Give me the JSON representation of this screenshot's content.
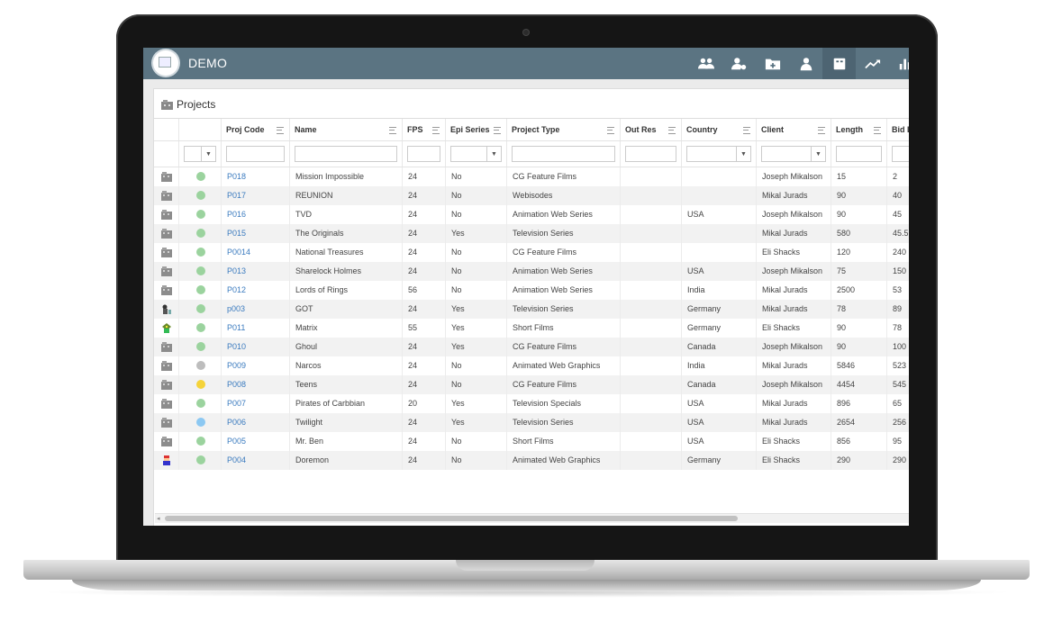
{
  "app": {
    "title": "DEMO"
  },
  "nav": {
    "icons": [
      "users-icon",
      "user-settings-icon",
      "add-folder-icon",
      "user-icon",
      "projects-icon",
      "trend-icon",
      "bar-chart-icon"
    ],
    "active_index": 4
  },
  "panel": {
    "title": "Projects"
  },
  "colors": {
    "topbar": "#5b7482",
    "link": "#3b7bbf",
    "status_green": "#9bd39e",
    "status_grey": "#bdbdbd",
    "status_yellow": "#f5d33a",
    "status_blue": "#8cc8f2"
  },
  "table": {
    "columns": [
      "",
      "",
      "Proj Code",
      "Name",
      "FPS",
      "Epi Series",
      "Project Type",
      "Out Res",
      "Country",
      "Client",
      "Length",
      "Bid L"
    ],
    "rows": [
      {
        "icon": "folder-icon",
        "status": "green",
        "code": "P018",
        "name": "Mission Impossible",
        "fps": "24",
        "epi": "No",
        "type": "CG Feature Films",
        "outres": "",
        "country": "",
        "client": "Joseph Mikalson",
        "length": "15",
        "bid": "2"
      },
      {
        "icon": "folder-icon",
        "status": "green",
        "code": "P017",
        "name": "REUNION",
        "fps": "24",
        "epi": "No",
        "type": "Webisodes",
        "outres": "",
        "country": "",
        "client": "Mikal Jurads",
        "length": "90",
        "bid": "40"
      },
      {
        "icon": "folder-icon",
        "status": "green",
        "code": "P016",
        "name": "TVD",
        "fps": "24",
        "epi": "No",
        "type": "Animation Web Series",
        "outres": "",
        "country": "USA",
        "client": "Joseph Mikalson",
        "length": "90",
        "bid": "45"
      },
      {
        "icon": "folder-icon",
        "status": "green",
        "code": "P015",
        "name": "The Originals",
        "fps": "24",
        "epi": "Yes",
        "type": "Television Series",
        "outres": "",
        "country": "",
        "client": "Mikal Jurads",
        "length": "580",
        "bid": "45.5"
      },
      {
        "icon": "folder-icon",
        "status": "green",
        "code": "P0014",
        "name": "National Treasures",
        "fps": "24",
        "epi": "No",
        "type": "CG Feature Films",
        "outres": "",
        "country": "",
        "client": "Eli Shacks",
        "length": "120",
        "bid": "240"
      },
      {
        "icon": "folder-icon",
        "status": "green",
        "code": "P013",
        "name": "Sharelock Holmes",
        "fps": "24",
        "epi": "No",
        "type": "Animation Web Series",
        "outres": "",
        "country": "USA",
        "client": "Joseph Mikalson",
        "length": "75",
        "bid": "150"
      },
      {
        "icon": "folder-icon",
        "status": "green",
        "code": "P012",
        "name": "Lords of Rings",
        "fps": "56",
        "epi": "No",
        "type": "Animation Web Series",
        "outres": "",
        "country": "India",
        "client": "Mikal Jurads",
        "length": "2500",
        "bid": "53"
      },
      {
        "icon": "character-icon",
        "status": "green",
        "code": "p003",
        "name": "GOT",
        "fps": "24",
        "epi": "Yes",
        "type": "Television Series",
        "outres": "",
        "country": "Germany",
        "client": "Mikal Jurads",
        "length": "78",
        "bid": "89"
      },
      {
        "icon": "sprite-icon",
        "status": "green",
        "code": "P011",
        "name": "Matrix",
        "fps": "55",
        "epi": "Yes",
        "type": "Short Films",
        "outres": "",
        "country": "Germany",
        "client": "Eli Shacks",
        "length": "90",
        "bid": "78"
      },
      {
        "icon": "folder-icon",
        "status": "green",
        "code": "P010",
        "name": "Ghoul",
        "fps": "24",
        "epi": "Yes",
        "type": "CG Feature Films",
        "outres": "",
        "country": "Canada",
        "client": "Joseph Mikalson",
        "length": "90",
        "bid": "100"
      },
      {
        "icon": "folder-icon",
        "status": "grey",
        "code": "P009",
        "name": "Narcos",
        "fps": "24",
        "epi": "No",
        "type": "Animated Web Graphics",
        "outres": "",
        "country": "India",
        "client": "Mikal Jurads",
        "length": "5846",
        "bid": "523"
      },
      {
        "icon": "folder-icon",
        "status": "yellow",
        "code": "P008",
        "name": "Teens",
        "fps": "24",
        "epi": "No",
        "type": "CG Feature Films",
        "outres": "",
        "country": "Canada",
        "client": "Joseph Mikalson",
        "length": "4454",
        "bid": "545"
      },
      {
        "icon": "folder-icon",
        "status": "green",
        "code": "P007",
        "name": "Pirates of Carbbian",
        "fps": "20",
        "epi": "Yes",
        "type": "Television Specials",
        "outres": "",
        "country": "USA",
        "client": "Mikal Jurads",
        "length": "896",
        "bid": "65"
      },
      {
        "icon": "folder-icon",
        "status": "blue",
        "code": "P006",
        "name": "Twilight",
        "fps": "24",
        "epi": "Yes",
        "type": "Television Series",
        "outres": "",
        "country": "USA",
        "client": "Mikal Jurads",
        "length": "2654",
        "bid": "256"
      },
      {
        "icon": "folder-icon",
        "status": "green",
        "code": "P005",
        "name": "Mr. Ben",
        "fps": "24",
        "epi": "No",
        "type": "Short Films",
        "outres": "",
        "country": "USA",
        "client": "Eli Shacks",
        "length": "856",
        "bid": "95"
      },
      {
        "icon": "mario-icon",
        "status": "green",
        "code": "P004",
        "name": "Doremon",
        "fps": "24",
        "epi": "No",
        "type": "Animated Web Graphics",
        "outres": "",
        "country": "Germany",
        "client": "Eli Shacks",
        "length": "290",
        "bid": "290"
      }
    ]
  }
}
